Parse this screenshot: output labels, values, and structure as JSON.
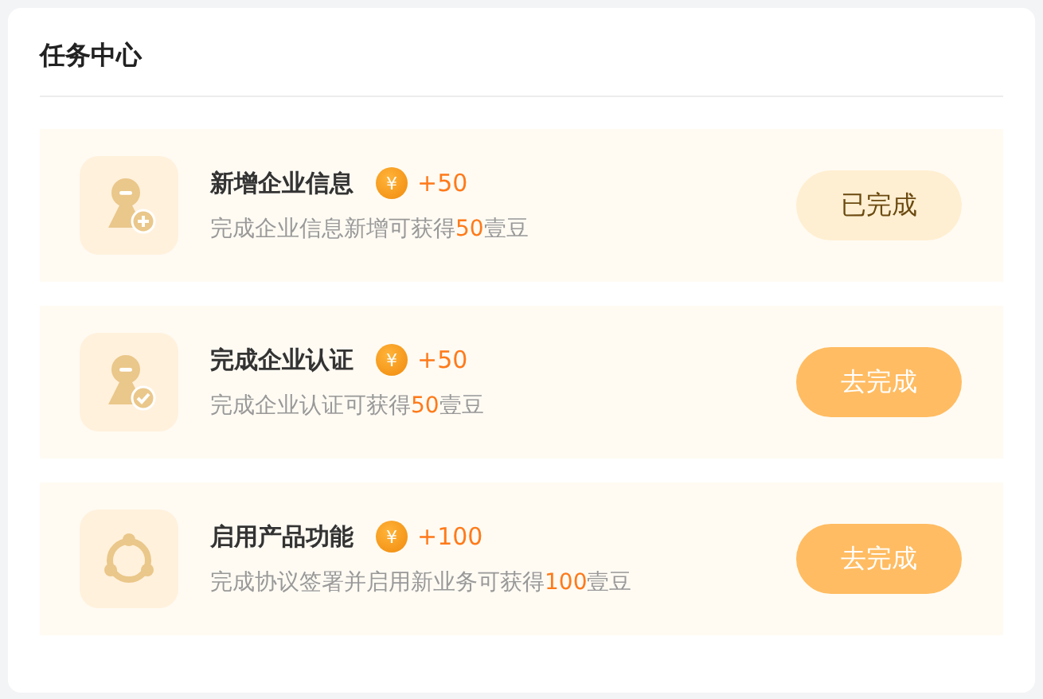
{
  "title": "任务中心",
  "tasks": [
    {
      "kind": "add-person",
      "name": "新增企业信息",
      "coin": "¥",
      "reward": "+50",
      "description": [
        {
          "text": "完成企业信息新增可获得",
          "highlight": false
        },
        {
          "text": "50",
          "highlight": true
        },
        {
          "text": "壹豆",
          "highlight": false
        }
      ],
      "button": "已完成",
      "done": true
    },
    {
      "kind": "verify-person",
      "name": "完成企业认证",
      "coin": "¥",
      "reward": "+50",
      "description": [
        {
          "text": "完成企业认证可获得",
          "highlight": false
        },
        {
          "text": "50",
          "highlight": true
        },
        {
          "text": "壹豆",
          "highlight": false
        }
      ],
      "button": "去完成",
      "done": false
    },
    {
      "kind": "ring",
      "name": "启用产品功能",
      "coin": "¥",
      "reward": "+100",
      "description": [
        {
          "text": "完成协议签署并启用新业务可获得",
          "highlight": false
        },
        {
          "text": "100",
          "highlight": true
        },
        {
          "text": "壹豆",
          "highlight": false
        }
      ],
      "button": "去完成",
      "done": false
    }
  ]
}
